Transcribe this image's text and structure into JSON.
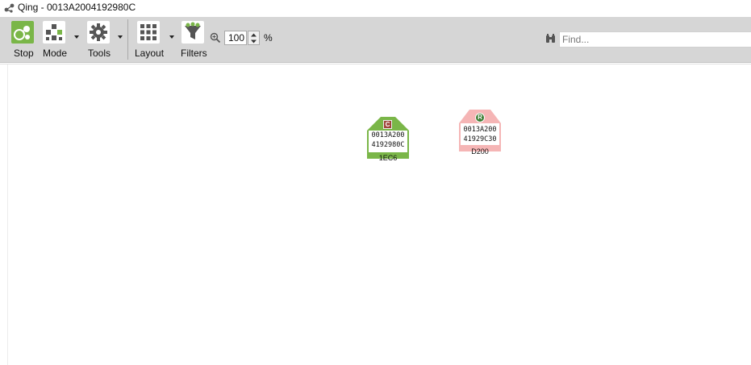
{
  "window": {
    "title": "Qing - 0013A2004192980C"
  },
  "toolbar": {
    "stop_label": "Stop",
    "mode_label": "Mode",
    "tools_label": "Tools",
    "layout_label": "Layout",
    "filters_label": "Filters",
    "zoom_value": "100",
    "zoom_unit": "%",
    "find_placeholder": "Find..."
  },
  "nodes": [
    {
      "badge": "C",
      "addr_line1": "0013A200",
      "addr_line2": "4192980C",
      "id": "1EC6",
      "color": "#7ab648",
      "badge_color": "#a0453b"
    },
    {
      "badge": "R",
      "addr_line1": "0013A200",
      "addr_line2": "41929C30",
      "id": "D200",
      "color": "#f5b5b5",
      "badge_color": "#3e7d34"
    }
  ],
  "colors": {
    "toolbar_bg": "#d6d6d6",
    "stop_icon_bg": "#7ab648",
    "icon_bg": "#ffffff",
    "icon_fg": "#555555"
  }
}
